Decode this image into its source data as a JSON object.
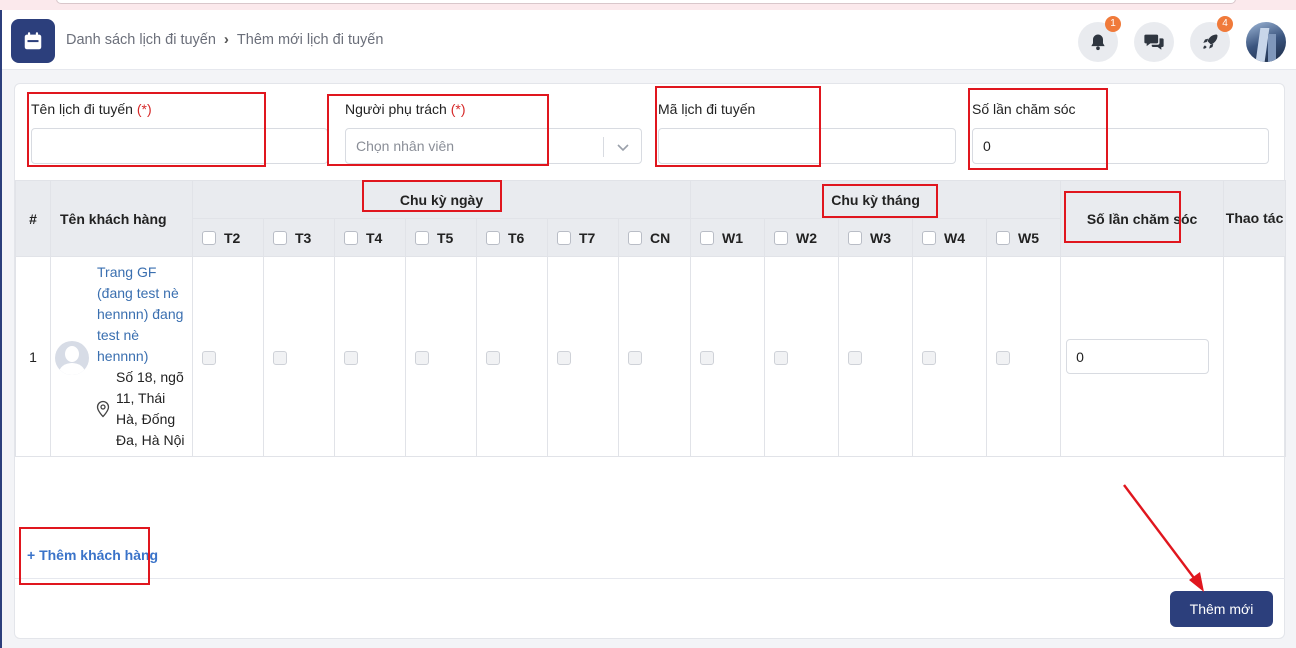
{
  "breadcrumb": {
    "parent": "Danh sách lịch đi tuyến",
    "current": "Thêm mới lịch đi tuyến"
  },
  "header": {
    "notifications_badge": "1",
    "rocket_badge": "4"
  },
  "form": {
    "route_name": {
      "label": "Tên lịch đi tuyến",
      "required": "(*)",
      "value": ""
    },
    "assignee": {
      "label": "Người phụ trách",
      "required": "(*)",
      "placeholder": "Chọn nhân viên"
    },
    "route_code": {
      "label": "Mã lịch đi tuyến",
      "value": ""
    },
    "care_count": {
      "label": "Số lần chăm sóc",
      "value": "0"
    }
  },
  "table": {
    "col_index": "#",
    "col_customer": "Tên khách hàng",
    "group_day": "Chu kỳ ngày",
    "group_month": "Chu kỳ tháng",
    "col_care_count": "Số lần chăm sóc",
    "col_actions": "Thao tác",
    "days": [
      "T2",
      "T3",
      "T4",
      "T5",
      "T6",
      "T7",
      "CN"
    ],
    "weeks": [
      "W1",
      "W2",
      "W3",
      "W4",
      "W5"
    ],
    "rows": [
      {
        "index": "1",
        "name": "Trang GF (đang test nè hennnn) đang test nè hennnn)",
        "address": "Số 18, ngõ 11, Thái Hà, Đống Đa, Hà Nội",
        "care_count": "0"
      }
    ]
  },
  "actions": {
    "add_customer": "+ Thêm khách hàng",
    "submit": "Thêm mới"
  },
  "colors": {
    "primary": "#2c3f7c",
    "annotation": "#e0161e",
    "link": "#3a73c9",
    "badge": "#f07a3a"
  }
}
